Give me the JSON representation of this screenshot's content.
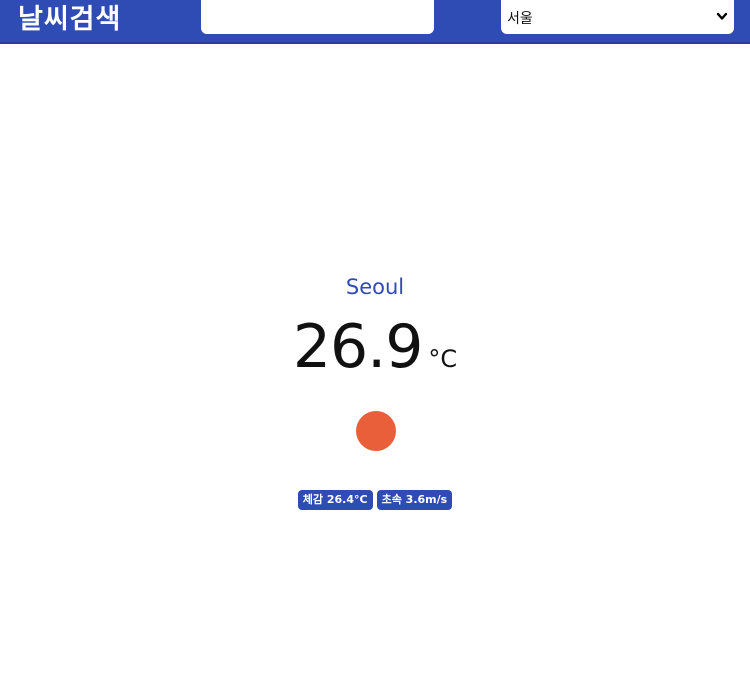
{
  "header": {
    "title": "날씨검색",
    "search": {
      "value": "",
      "placeholder": ""
    },
    "city_select": {
      "selected": "서울",
      "icon": "chevron-down-icon"
    }
  },
  "weather": {
    "city": "Seoul",
    "temperature": "26.9",
    "unit": "°C",
    "condition_icon": "sun-icon",
    "condition_color": "#e95f3a",
    "feels_like": "체감 26.4°C",
    "wind_speed": "초속 3.6m/s"
  },
  "colors": {
    "brand": "#2f4bb4",
    "background": "#ffffff"
  }
}
